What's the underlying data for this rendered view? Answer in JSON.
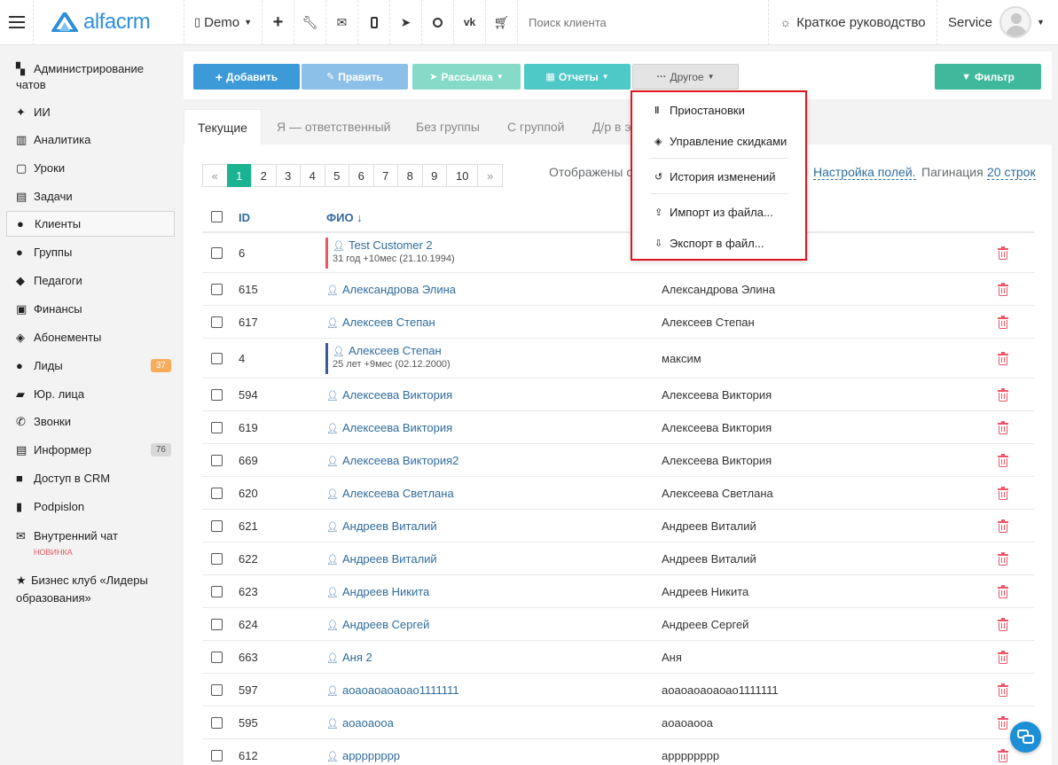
{
  "topbar": {
    "logo": "alfacrm",
    "branch": "Demo",
    "search_placeholder": "Поиск клиента",
    "guide": "Краткое руководство",
    "user": "Service"
  },
  "sidebar": {
    "items": [
      {
        "label": "Администрирование чатов",
        "icon": "chats-icon"
      },
      {
        "label": "ИИ",
        "icon": "sparkles-icon"
      },
      {
        "label": "Аналитика",
        "icon": "map-icon"
      },
      {
        "label": "Уроки",
        "icon": "calendar-icon"
      },
      {
        "label": "Задачи",
        "icon": "clipboard-icon"
      },
      {
        "label": "Клиенты",
        "icon": "user-icon"
      },
      {
        "label": "Группы",
        "icon": "users-icon"
      },
      {
        "label": "Педагоги",
        "icon": "graduation-cap-icon"
      },
      {
        "label": "Финансы",
        "icon": "money-icon"
      },
      {
        "label": "Абонементы",
        "icon": "tag-icon"
      },
      {
        "label": "Лиды",
        "icon": "user-plus-icon",
        "badge": "37"
      },
      {
        "label": "Юр. лица",
        "icon": "briefcase-icon"
      },
      {
        "label": "Звонки",
        "icon": "phone-icon"
      },
      {
        "label": "Информер",
        "icon": "newspaper-icon",
        "badge": "76"
      },
      {
        "label": "Доступ в CRM",
        "icon": "lock-icon"
      },
      {
        "label": "Podpislon",
        "icon": "file-icon"
      },
      {
        "label": "Внутренний чат",
        "icon": "envelope-icon",
        "tag": "НОВИНКА"
      },
      {
        "label": "Бизнес клуб «Лидеры образования»",
        "icon": "star-icon"
      }
    ]
  },
  "toolbar": {
    "add": "Добавить",
    "edit": "Править",
    "mailing": "Рассылка",
    "reports": "Отчеты",
    "other": "Другое",
    "filter": "Фильтр"
  },
  "tabs": [
    "Текущие",
    "Я — ответственный",
    "Без группы",
    "С группой",
    "Д/р в э"
  ],
  "pagination": {
    "pages": [
      "«",
      "1",
      "2",
      "3",
      "4",
      "5",
      "6",
      "7",
      "8",
      "9",
      "10",
      "»"
    ],
    "current": "1",
    "shown_prefix": "Отображены с",
    "field_setup": "Настройка полей.",
    "pagination_label": "Пагинация",
    "per_page": "20 строк"
  },
  "table": {
    "headers": {
      "id": "ID",
      "fio": "ФИО ↓"
    },
    "rows": [
      {
        "id": "6",
        "fio": "Test Customer 2",
        "age": "31 год +10мес (21.10.1994)",
        "col3": "",
        "bar": "#ed5565"
      },
      {
        "id": "615",
        "fio": "Александрова Элина",
        "col3": "Александрова Элина"
      },
      {
        "id": "617",
        "fio": "Алексеев Степан",
        "col3": "Алексеев Степан"
      },
      {
        "id": "4",
        "fio": "Алексеев Степан",
        "age": "25 лет +9мес (02.12.2000)",
        "col3": "максим",
        "bar": "#3b5998"
      },
      {
        "id": "594",
        "fio": "Алексеева Виктория",
        "col3": "Алексеева Виктория"
      },
      {
        "id": "619",
        "fio": "Алексеева Виктория",
        "col3": "Алексеева Виктория"
      },
      {
        "id": "669",
        "fio": "Алексеева Виктория2",
        "col3": "Алексеева Виктория"
      },
      {
        "id": "620",
        "fio": "Алексеева Светлана",
        "col3": "Алексеева Светлана"
      },
      {
        "id": "621",
        "fio": "Андреев Виталий",
        "col3": "Андреев Виталий"
      },
      {
        "id": "622",
        "fio": "Андреев Виталий",
        "col3": "Андреев Виталий"
      },
      {
        "id": "623",
        "fio": "Андреев Никита",
        "col3": "Андреев Никита"
      },
      {
        "id": "624",
        "fio": "Андреев Сергей",
        "col3": "Андреев Сергей"
      },
      {
        "id": "663",
        "fio": "Аня 2",
        "col3": "Аня"
      },
      {
        "id": "597",
        "fio": "аоаоаоаоаоао1111111",
        "col3": "аоаоаоаоаоао1111111"
      },
      {
        "id": "595",
        "fio": "аоаоаооа",
        "col3": "аоаоаооа"
      },
      {
        "id": "612",
        "fio": "арррррррр",
        "col3": "арррррррр"
      }
    ]
  },
  "dropdown": {
    "items": [
      {
        "label": "Приостановки",
        "icon": "pause-icon"
      },
      {
        "label": "Управление скидками",
        "icon": "tag-icon"
      },
      {
        "label": "История изменений",
        "icon": "history-icon"
      },
      {
        "label": "Импорт из файла...",
        "icon": "upload-icon"
      },
      {
        "label": "Экспорт в файл...",
        "icon": "download-icon"
      }
    ]
  },
  "colors": {
    "primary": "#1ab394",
    "blue": "#3d9ad9",
    "link": "#2f6c9e",
    "danger": "#ed5565",
    "highlight": "#e0161c"
  }
}
